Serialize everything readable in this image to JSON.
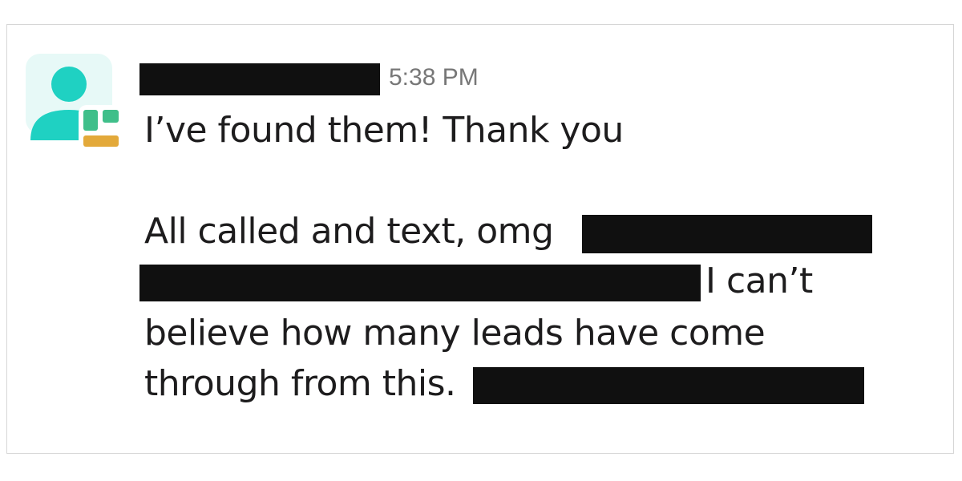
{
  "message": {
    "sender_name": "",
    "timestamp": "5:38 PM",
    "lines": [
      "I’ve found them! Thank you",
      "All called and text, omg",
      "I can’t",
      "believe how many leads have come",
      "through from this."
    ]
  },
  "colors": {
    "avatar_teal": "#1fd1c2",
    "avatar_bg": "#e7f9f7",
    "badge_green": "#3fbf8a",
    "badge_yellow": "#e3a93a",
    "redaction": "#101010",
    "text": "#1d1c1d",
    "timestamp": "#777777"
  },
  "icons": {
    "avatar": "user-avatar-icon",
    "status_badge": "app-badge-icon"
  }
}
